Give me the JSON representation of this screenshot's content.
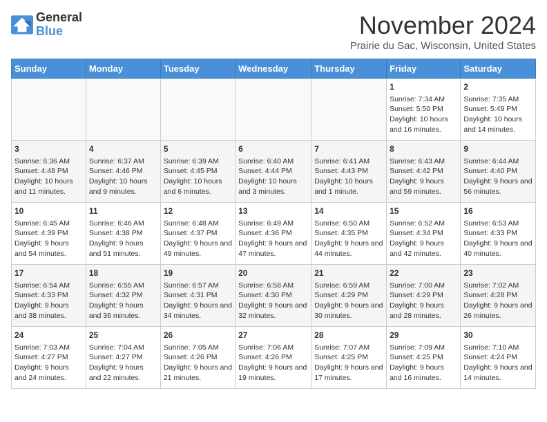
{
  "logo": {
    "line1": "General",
    "line2": "Blue"
  },
  "title": "November 2024",
  "subtitle": "Prairie du Sac, Wisconsin, United States",
  "days_of_week": [
    "Sunday",
    "Monday",
    "Tuesday",
    "Wednesday",
    "Thursday",
    "Friday",
    "Saturday"
  ],
  "weeks": [
    [
      {
        "day": "",
        "info": ""
      },
      {
        "day": "",
        "info": ""
      },
      {
        "day": "",
        "info": ""
      },
      {
        "day": "",
        "info": ""
      },
      {
        "day": "",
        "info": ""
      },
      {
        "day": "1",
        "info": "Sunrise: 7:34 AM\nSunset: 5:50 PM\nDaylight: 10 hours and 16 minutes."
      },
      {
        "day": "2",
        "info": "Sunrise: 7:35 AM\nSunset: 5:49 PM\nDaylight: 10 hours and 14 minutes."
      }
    ],
    [
      {
        "day": "3",
        "info": "Sunrise: 6:36 AM\nSunset: 4:48 PM\nDaylight: 10 hours and 11 minutes."
      },
      {
        "day": "4",
        "info": "Sunrise: 6:37 AM\nSunset: 4:46 PM\nDaylight: 10 hours and 9 minutes."
      },
      {
        "day": "5",
        "info": "Sunrise: 6:39 AM\nSunset: 4:45 PM\nDaylight: 10 hours and 6 minutes."
      },
      {
        "day": "6",
        "info": "Sunrise: 6:40 AM\nSunset: 4:44 PM\nDaylight: 10 hours and 3 minutes."
      },
      {
        "day": "7",
        "info": "Sunrise: 6:41 AM\nSunset: 4:43 PM\nDaylight: 10 hours and 1 minute."
      },
      {
        "day": "8",
        "info": "Sunrise: 6:43 AM\nSunset: 4:42 PM\nDaylight: 9 hours and 59 minutes."
      },
      {
        "day": "9",
        "info": "Sunrise: 6:44 AM\nSunset: 4:40 PM\nDaylight: 9 hours and 56 minutes."
      }
    ],
    [
      {
        "day": "10",
        "info": "Sunrise: 6:45 AM\nSunset: 4:39 PM\nDaylight: 9 hours and 54 minutes."
      },
      {
        "day": "11",
        "info": "Sunrise: 6:46 AM\nSunset: 4:38 PM\nDaylight: 9 hours and 51 minutes."
      },
      {
        "day": "12",
        "info": "Sunrise: 6:48 AM\nSunset: 4:37 PM\nDaylight: 9 hours and 49 minutes."
      },
      {
        "day": "13",
        "info": "Sunrise: 6:49 AM\nSunset: 4:36 PM\nDaylight: 9 hours and 47 minutes."
      },
      {
        "day": "14",
        "info": "Sunrise: 6:50 AM\nSunset: 4:35 PM\nDaylight: 9 hours and 44 minutes."
      },
      {
        "day": "15",
        "info": "Sunrise: 6:52 AM\nSunset: 4:34 PM\nDaylight: 9 hours and 42 minutes."
      },
      {
        "day": "16",
        "info": "Sunrise: 6:53 AM\nSunset: 4:33 PM\nDaylight: 9 hours and 40 minutes."
      }
    ],
    [
      {
        "day": "17",
        "info": "Sunrise: 6:54 AM\nSunset: 4:33 PM\nDaylight: 9 hours and 38 minutes."
      },
      {
        "day": "18",
        "info": "Sunrise: 6:55 AM\nSunset: 4:32 PM\nDaylight: 9 hours and 36 minutes."
      },
      {
        "day": "19",
        "info": "Sunrise: 6:57 AM\nSunset: 4:31 PM\nDaylight: 9 hours and 34 minutes."
      },
      {
        "day": "20",
        "info": "Sunrise: 6:58 AM\nSunset: 4:30 PM\nDaylight: 9 hours and 32 minutes."
      },
      {
        "day": "21",
        "info": "Sunrise: 6:59 AM\nSunset: 4:29 PM\nDaylight: 9 hours and 30 minutes."
      },
      {
        "day": "22",
        "info": "Sunrise: 7:00 AM\nSunset: 4:29 PM\nDaylight: 9 hours and 28 minutes."
      },
      {
        "day": "23",
        "info": "Sunrise: 7:02 AM\nSunset: 4:28 PM\nDaylight: 9 hours and 26 minutes."
      }
    ],
    [
      {
        "day": "24",
        "info": "Sunrise: 7:03 AM\nSunset: 4:27 PM\nDaylight: 9 hours and 24 minutes."
      },
      {
        "day": "25",
        "info": "Sunrise: 7:04 AM\nSunset: 4:27 PM\nDaylight: 9 hours and 22 minutes."
      },
      {
        "day": "26",
        "info": "Sunrise: 7:05 AM\nSunset: 4:26 PM\nDaylight: 9 hours and 21 minutes."
      },
      {
        "day": "27",
        "info": "Sunrise: 7:06 AM\nSunset: 4:26 PM\nDaylight: 9 hours and 19 minutes."
      },
      {
        "day": "28",
        "info": "Sunrise: 7:07 AM\nSunset: 4:25 PM\nDaylight: 9 hours and 17 minutes."
      },
      {
        "day": "29",
        "info": "Sunrise: 7:09 AM\nSunset: 4:25 PM\nDaylight: 9 hours and 16 minutes."
      },
      {
        "day": "30",
        "info": "Sunrise: 7:10 AM\nSunset: 4:24 PM\nDaylight: 9 hours and 14 minutes."
      }
    ]
  ]
}
